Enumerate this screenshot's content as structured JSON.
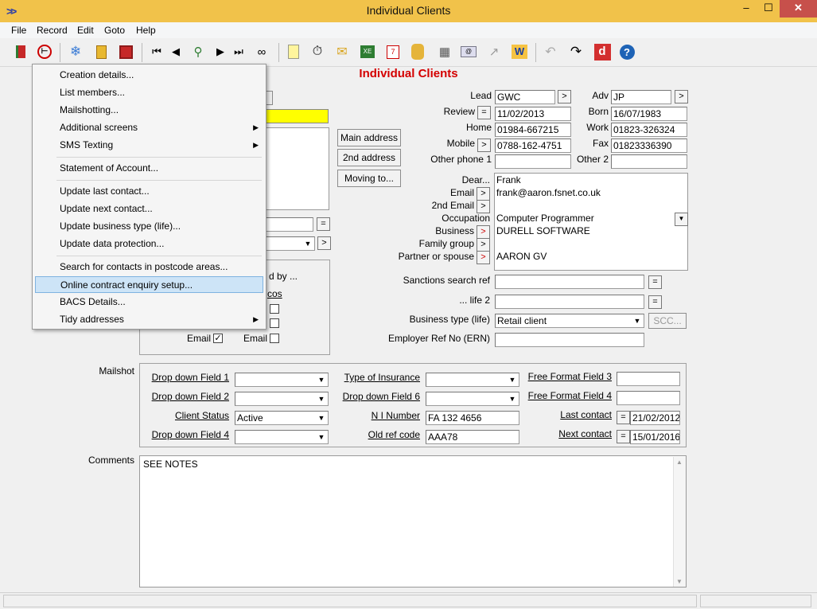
{
  "window": {
    "title": "Individual Clients",
    "minimize": "‒",
    "maximize": "☐",
    "close": "✕"
  },
  "menubar": [
    "File",
    "Record",
    "Edit",
    "Goto",
    "Help"
  ],
  "toolbar": {
    "icons": [
      "exit-icon",
      "no-entry-icon",
      "snowflake-icon",
      "trash-icon",
      "save-icon",
      "first-record-icon",
      "prev-record-icon",
      "find-icon",
      "next-record-icon",
      "last-record-icon",
      "glasses-icon",
      "notes-icon",
      "stopwatch-icon",
      "letter-icon",
      "excel-icon",
      "calendar-icon",
      "coins-icon",
      "calculator-icon",
      "email-icon",
      "chart-icon",
      "word-icon",
      "undo-icon",
      "redo-icon",
      "d-logo-icon",
      "help-icon"
    ]
  },
  "header": {
    "title": "Individual Clients"
  },
  "popup_menu": {
    "items": [
      {
        "label": "Creation details...",
        "submenu": false
      },
      {
        "label": "List members...",
        "submenu": false
      },
      {
        "label": "Mailshotting...",
        "submenu": false
      },
      {
        "label": "Additional screens",
        "submenu": true
      },
      {
        "label": "SMS Texting",
        "submenu": true
      },
      {
        "label": "Statement of Account...",
        "submenu": false
      },
      {
        "label": "Update last contact...",
        "submenu": false
      },
      {
        "label": "Update next contact...",
        "submenu": false
      },
      {
        "label": "Update business type (life)...",
        "submenu": false
      },
      {
        "label": "Update data protection...",
        "submenu": false
      },
      {
        "label": "Search for contacts in postcode areas...",
        "submenu": false
      },
      {
        "label": "Online contract enquiry setup...",
        "submenu": false,
        "highlighted": true
      },
      {
        "label": "BACS Details...",
        "submenu": false
      },
      {
        "label": "Tidy addresses",
        "submenu": true
      }
    ]
  },
  "address_buttons": {
    "main": "Main address",
    "second": "2nd address",
    "moving": "Moving to..."
  },
  "left_partial": {
    "by_text": "d by ...",
    "cos_text": "cos",
    "email_label_1": "Email",
    "email_label_2": "Email",
    "email_checked": true
  },
  "contact": {
    "lead_label": "Lead",
    "lead": "GWC",
    "adv_label": "Adv",
    "adv": "JP",
    "review_label": "Review",
    "review": "11/02/2013",
    "born_label": "Born",
    "born": "16/07/1983",
    "home_label": "Home",
    "home": "01984-667215",
    "work_label": "Work",
    "work": "01823-326324",
    "mobile_label": "Mobile",
    "mobile": "0788-162-4751",
    "fax_label": "Fax",
    "fax": "01823336390",
    "other_phone1_label": "Other phone 1",
    "other_phone1": "",
    "other2_label": "Other 2",
    "other2": ""
  },
  "details": {
    "dear_label": "Dear...",
    "dear": "Frank",
    "email_label": "Email",
    "email": "frank@aaron.fsnet.co.uk",
    "email2_label": "2nd Email",
    "email2": "",
    "occupation_label": "Occupation",
    "occupation": "Computer Programmer",
    "business_label": "Business",
    "business": "DURELL SOFTWARE",
    "family_label": "Family group",
    "family": "",
    "partner_label": "Partner or spouse",
    "partner": "AARON GV"
  },
  "sanctions": {
    "ref_label": "Sanctions search ref",
    "ref": "",
    "life2_label": "... life 2",
    "life2": "",
    "business_type_label": "Business type (life)",
    "business_type": "Retail client",
    "scc_button": "SCC...",
    "employer_ref_label": "Employer Ref No (ERN)",
    "employer_ref": ""
  },
  "mailshot": {
    "label": "Mailshot",
    "dd1_label": "Drop down Field 1",
    "dd1": "",
    "dd2_label": "Drop down Field 2",
    "dd2": "",
    "status_label": "Client Status",
    "status": "Active",
    "dd4_label": "Drop down Field 4",
    "dd4": "",
    "insurance_label": "Type of Insurance",
    "insurance": "",
    "dd6_label": "Drop down Field 6",
    "dd6": "",
    "ni_label": "N I Number",
    "ni": "FA 132 4656",
    "oldref_label": "Old ref code",
    "oldref": "AAA78",
    "ff3_label": "Free Format Field 3",
    "ff3": "",
    "ff4_label": "Free Format Field 4",
    "ff4": "",
    "last_contact_label": "Last contact",
    "last_contact": "21/02/2012",
    "next_contact_label": "Next contact",
    "next_contact": "15/01/2016"
  },
  "comments": {
    "label": "Comments",
    "text": "SEE NOTES"
  },
  "colors": {
    "title_bar": "#f1c24a",
    "header_red": "#d40000",
    "yellow_field": "#ffff00",
    "menu_highlight": "#cde4f7"
  }
}
